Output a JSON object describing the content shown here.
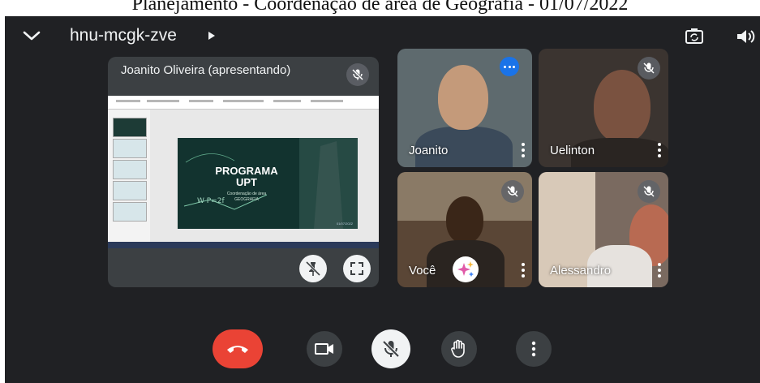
{
  "caption": "Planejamento - Coordenação de área de Geografia - 01/07/2022",
  "header": {
    "meeting_code": "hnu-mcgk-zve",
    "icons": [
      "chevron-down-icon",
      "caret-right-icon",
      "switch-camera-icon",
      "speaker-icon"
    ]
  },
  "presenter": {
    "label": "Joanito Oliveira (apresentando)",
    "slide": {
      "title_line1": "PROGRAMA",
      "title_line2": "UPT",
      "subtitle_line1": "Coordenação de área",
      "subtitle_line2": "GEOGRAFIA",
      "date": "01/07/2022"
    },
    "actions": [
      "pin-off-icon",
      "fullscreen-icon"
    ]
  },
  "participants": [
    {
      "name": "Joanito",
      "muted": false,
      "badge": "more-options"
    },
    {
      "name": "Uelinton",
      "muted": true
    },
    {
      "name": "Você",
      "muted": true,
      "badge": "visual-effects"
    },
    {
      "name": "Alessandro",
      "muted": true
    }
  ],
  "controls": [
    "end-call",
    "camera",
    "microphone-off",
    "raise-hand",
    "more-options"
  ],
  "colors": {
    "background": "#202124",
    "tile": "#3c4043",
    "end_call": "#ea4335",
    "accent": "#1a73e8",
    "light_button": "#f1f3f4"
  }
}
